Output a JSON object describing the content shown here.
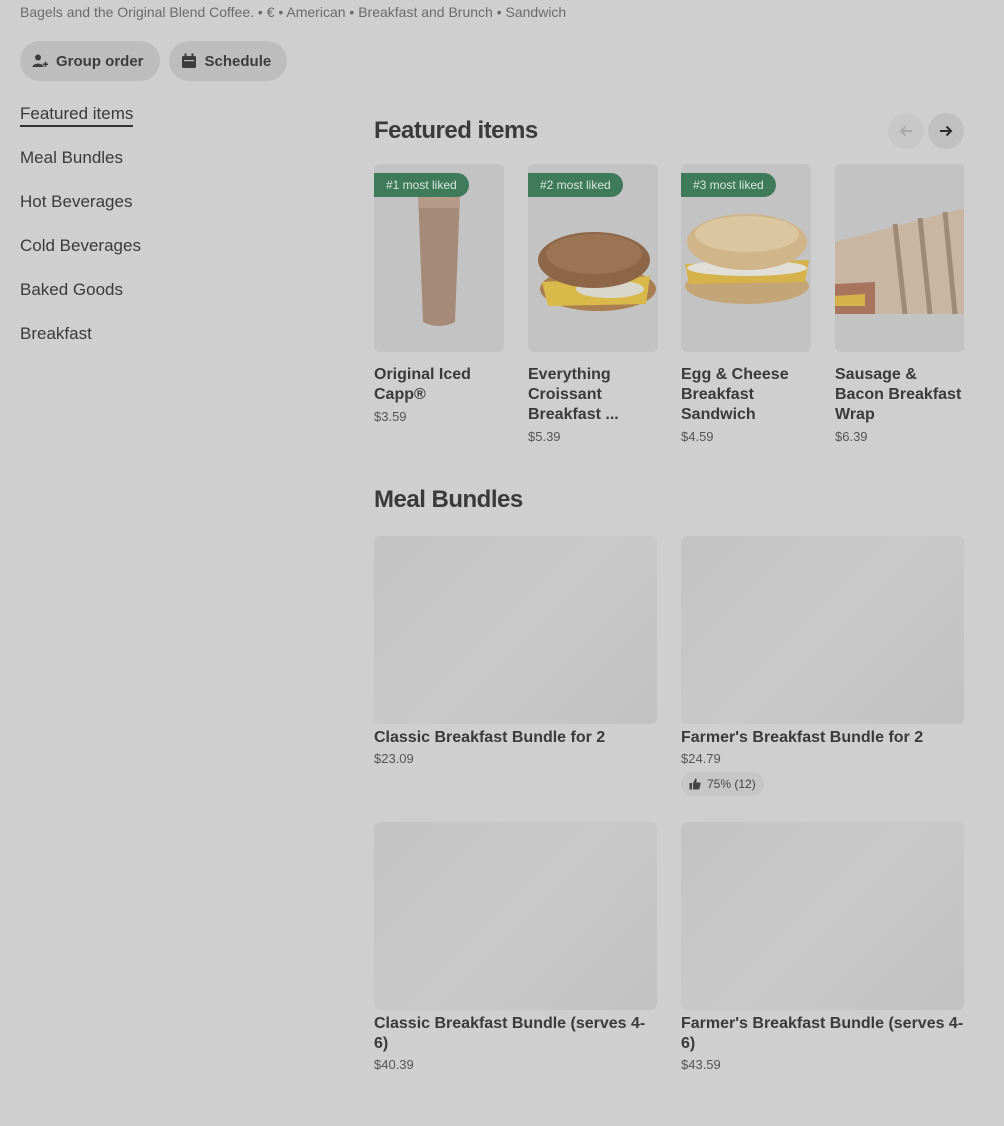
{
  "header": {
    "subtitle": "Bagels and the Original Blend Coffee. • € • American • Breakfast and Brunch • Sandwich"
  },
  "actions": {
    "group_order": "Group order",
    "schedule": "Schedule"
  },
  "sidebar": {
    "items": [
      {
        "label": "Featured items"
      },
      {
        "label": "Meal Bundles"
      },
      {
        "label": "Hot Beverages"
      },
      {
        "label": "Cold Beverages"
      },
      {
        "label": "Baked Goods"
      },
      {
        "label": "Breakfast"
      }
    ]
  },
  "featured": {
    "title": "Featured items",
    "items": [
      {
        "badge": "#1 most liked",
        "name": "Original Iced Capp®",
        "price": "$3.59"
      },
      {
        "badge": "#2 most liked",
        "name": "Everything Croissant Breakfast ...",
        "price": "$5.39"
      },
      {
        "badge": "#3 most liked",
        "name": "Egg & Cheese Breakfast Sandwich",
        "price": "$4.59"
      },
      {
        "badge": "",
        "name": "Sausage & Bacon Breakfast Wrap",
        "price": "$6.39"
      }
    ]
  },
  "bundles": {
    "title": "Meal Bundles",
    "items": [
      {
        "name": "Classic Breakfast Bundle for 2",
        "price": "$23.09",
        "rating": ""
      },
      {
        "name": "Farmer's Breakfast Bundle for 2",
        "price": "$24.79",
        "rating": "75% (12)"
      },
      {
        "name": "Classic Breakfast Bundle (serves 4-6)",
        "price": "$40.39",
        "rating": ""
      },
      {
        "name": "Farmer's Breakfast Bundle (serves 4-6)",
        "price": "$43.59",
        "rating": ""
      }
    ]
  },
  "colors": {
    "badge_green": "#3f7a5a",
    "overlay_gray": "#cfcfcf"
  }
}
